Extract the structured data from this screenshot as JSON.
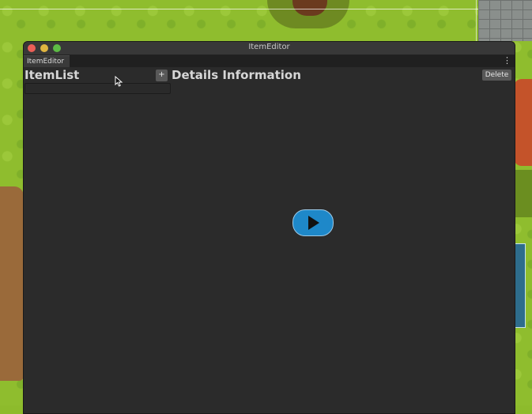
{
  "window": {
    "title": "ItemEditor",
    "tab_label": "ItemEditor",
    "menu_icon": "more-vertical-icon"
  },
  "left_panel": {
    "title": "ItemList",
    "add_label": "+"
  },
  "right_panel": {
    "title": "Details Information",
    "delete_label": "Delete"
  },
  "overlay": {
    "play_icon": "play-icon"
  },
  "colors": {
    "window_bg": "#2b2b2b",
    "play_accent": "#1e88c9",
    "close": "#ec5f57",
    "minimize": "#e0b540",
    "maximize": "#5dbb45"
  }
}
